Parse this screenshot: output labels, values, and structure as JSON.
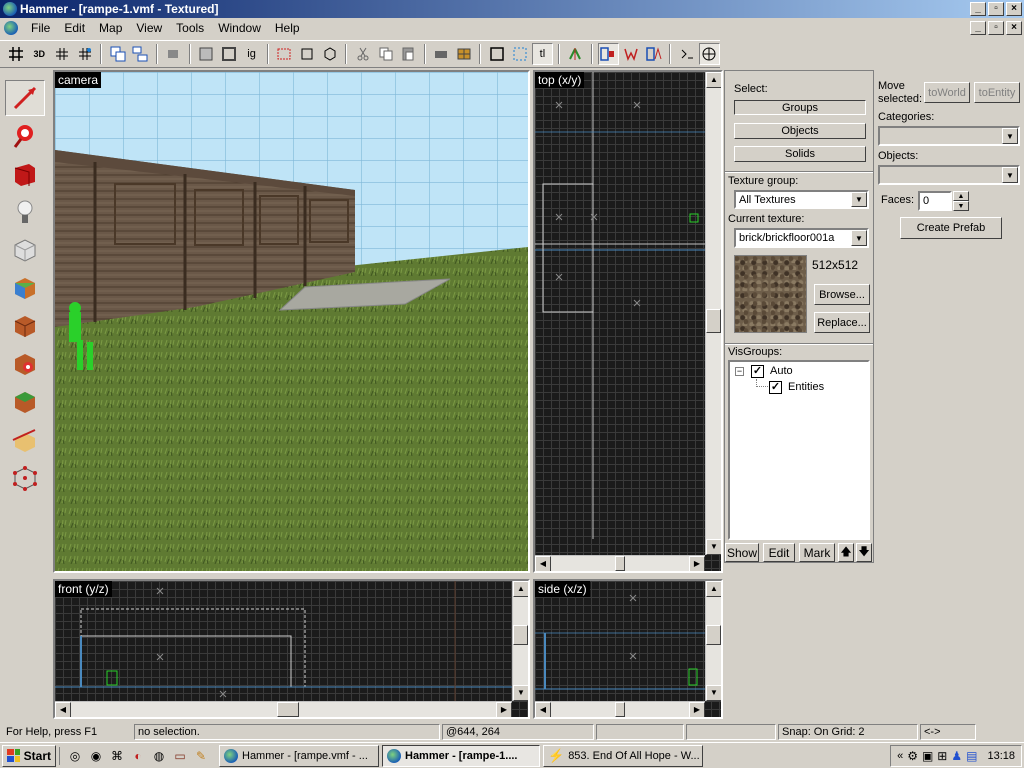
{
  "window": {
    "title": "Hammer - [rampe-1.vmf - Textured]",
    "caption_min": "_",
    "caption_max": "▫",
    "caption_close": "×"
  },
  "menu": [
    "File",
    "Edit",
    "Map",
    "View",
    "Tools",
    "Window",
    "Help"
  ],
  "toolbar": {
    "map_label": "3D",
    "ig_label": "ig",
    "tl_label": "tl"
  },
  "viewports": {
    "camera": "camera",
    "top": "top (x/y)",
    "front": "front (y/z)",
    "side": "side (x/z)"
  },
  "select_panel": {
    "label": "Select:",
    "groups": "Groups",
    "objects": "Objects",
    "solids": "Solids"
  },
  "texture_panel": {
    "group_label": "Texture group:",
    "group_value": "All Textures",
    "current_label": "Current texture:",
    "current_value": "brick/brickfloor001a",
    "size": "512x512",
    "browse": "Browse...",
    "replace": "Replace..."
  },
  "visgroups": {
    "label": "VisGroups:",
    "tree_expand": "−",
    "items": [
      {
        "name": "Auto",
        "checked": true
      },
      {
        "name": "Entities",
        "checked": true
      }
    ],
    "check_glyph": "✓",
    "show": "Show",
    "edit": "Edit",
    "mark": "Mark",
    "up": "🡅",
    "down": "🡇"
  },
  "move_panel": {
    "label_line1": "Move",
    "label_line2": "selected:",
    "to_world": "toWorld",
    "to_entity": "toEntity",
    "categories_label": "Categories:",
    "objects_label": "Objects:",
    "faces_label": "Faces:",
    "faces_value": "0",
    "create_prefab": "Create Prefab"
  },
  "statusbar": {
    "help": "For Help, press F1",
    "selection": "no selection.",
    "coords": "@644, 264",
    "snap": "Snap: On Grid: 2",
    "extra": "<->"
  },
  "taskbar": {
    "start": "Start",
    "tasks": [
      {
        "label": "Hammer - [rampe.vmf - ...",
        "active": false
      },
      {
        "label": "Hammer - [rampe-1....",
        "active": true
      },
      {
        "label": "853. End Of All Hope - W...",
        "active": false
      }
    ],
    "tray_arrows": "«",
    "time": "13:18"
  },
  "colors": {
    "title_start": "#0a246a",
    "title_end": "#a6caf0",
    "chrome": "#d4d0c8",
    "grid_bg": "#1b1b1b"
  }
}
